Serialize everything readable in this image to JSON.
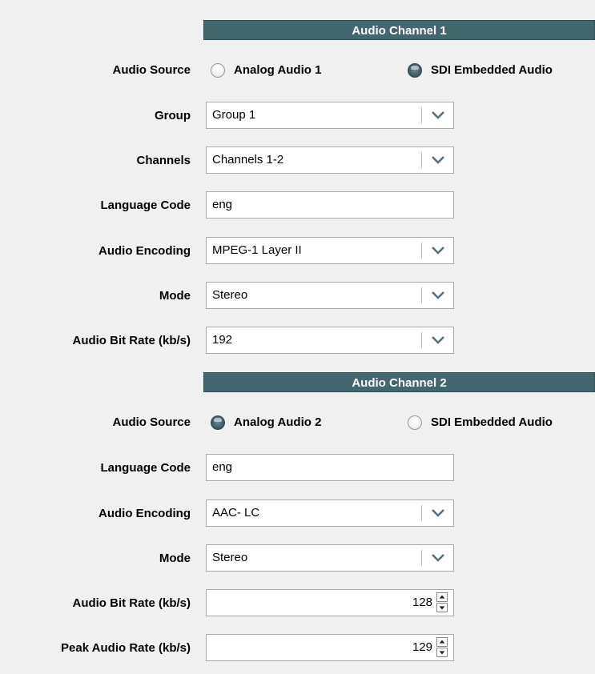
{
  "channel1": {
    "header": "Audio Channel 1",
    "audio_source": {
      "label": "Audio Source",
      "options": [
        "Analog Audio 1",
        "SDI Embedded Audio"
      ],
      "selected": "SDI Embedded Audio"
    },
    "group": {
      "label": "Group",
      "value": "Group 1"
    },
    "channels": {
      "label": "Channels",
      "value": "Channels 1-2"
    },
    "language_code": {
      "label": "Language Code",
      "value": "eng"
    },
    "audio_encoding": {
      "label": "Audio Encoding",
      "value": "MPEG-1 Layer II"
    },
    "mode": {
      "label": "Mode",
      "value": "Stereo"
    },
    "audio_bit_rate": {
      "label": "Audio Bit Rate (kb/s)",
      "value": "192"
    }
  },
  "channel2": {
    "header": "Audio Channel 2",
    "audio_source": {
      "label": "Audio Source",
      "options": [
        "Analog Audio 2",
        "SDI Embedded Audio"
      ],
      "selected": "Analog Audio 2"
    },
    "language_code": {
      "label": "Language Code",
      "value": "eng"
    },
    "audio_encoding": {
      "label": "Audio Encoding",
      "value": "AAC- LC"
    },
    "mode": {
      "label": "Mode",
      "value": "Stereo"
    },
    "audio_bit_rate": {
      "label": "Audio Bit Rate (kb/s)",
      "value": "128"
    },
    "peak_audio_rate": {
      "label": "Peak Audio Rate (kb/s)",
      "value": "129"
    }
  },
  "icons": {
    "dropdown": "chevron-down-icon",
    "spin_up": "caret-up-icon",
    "spin_down": "caret-down-icon"
  },
  "colors": {
    "header_bg": "#42676f",
    "background": "#f0f0f0",
    "radio_selected": "#33505c"
  }
}
